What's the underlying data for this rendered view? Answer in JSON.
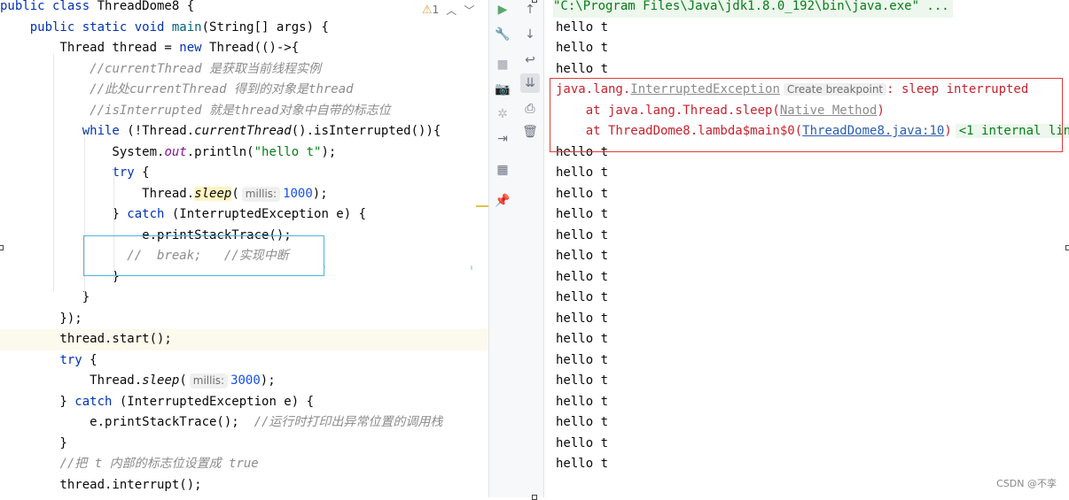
{
  "editor": {
    "warning_count": "1",
    "lines": [
      [
        [
          "kw",
          "public class "
        ],
        [
          "",
          "ThreadDome8 {"
        ]
      ],
      [
        [
          "",
          "    "
        ],
        [
          "kw",
          "public static void "
        ],
        [
          "fn",
          "main"
        ],
        [
          "",
          "(String[] args) {"
        ]
      ],
      [
        [
          "",
          "        Thread thread = "
        ],
        [
          "kw",
          "new "
        ],
        [
          "",
          "Thread(()->{"
        ]
      ],
      [
        [
          "",
          "            "
        ],
        [
          "cmt",
          "//currentThread 是获取当前线程实例"
        ]
      ],
      [
        [
          "",
          "            "
        ],
        [
          "cmt",
          "//此处currentThread 得到的对象是thread"
        ]
      ],
      [
        [
          "",
          "            "
        ],
        [
          "cmt",
          "//isInterrupted 就是thread对象中自带的标志位"
        ]
      ],
      [
        [
          "",
          "           "
        ],
        [
          "kw",
          "while "
        ],
        [
          "",
          "(!Thread."
        ],
        [
          "it",
          "currentThread"
        ],
        [
          "",
          "().isInterrupted()){"
        ]
      ],
      [
        [
          "",
          "               System."
        ],
        [
          "fld",
          "out"
        ],
        [
          "",
          ".println("
        ],
        [
          "str",
          "\"hello t\""
        ],
        [
          "",
          ");"
        ]
      ],
      [
        [
          "",
          "               "
        ],
        [
          "kw",
          "try "
        ],
        [
          "",
          "{"
        ]
      ],
      [
        [
          "",
          "                   Thread."
        ],
        [
          "it hint2",
          "sleep"
        ],
        [
          "",
          "("
        ],
        [
          "hint",
          "millis:"
        ],
        [
          "num",
          "1000"
        ],
        [
          "",
          ");"
        ]
      ],
      [
        [
          "",
          "               } "
        ],
        [
          "kw",
          "catch "
        ],
        [
          "",
          "(InterruptedException e) {"
        ]
      ],
      [
        [
          "",
          "                   e.printStackTrace();"
        ]
      ],
      [
        [
          "",
          "                 "
        ],
        [
          "cmt",
          "//  break;   //实现中断"
        ]
      ],
      [
        [
          "",
          "               }"
        ]
      ],
      [
        [
          "",
          "           }"
        ]
      ],
      [
        [
          "",
          "        });"
        ]
      ],
      [
        [
          "",
          "        thread.start();"
        ]
      ],
      [
        [
          "",
          "        "
        ],
        [
          "kw",
          "try "
        ],
        [
          "",
          "{"
        ]
      ],
      [
        [
          "",
          "            Thread."
        ],
        [
          "it",
          "sleep"
        ],
        [
          "",
          "("
        ],
        [
          "hint",
          "millis:"
        ],
        [
          "num",
          "3000"
        ],
        [
          "",
          ");"
        ]
      ],
      [
        [
          "",
          "        } "
        ],
        [
          "kw",
          "catch "
        ],
        [
          "",
          "(InterruptedException e) {"
        ]
      ],
      [
        [
          "",
          "            e.printStackTrace();  "
        ],
        [
          "cmt",
          "//运行时打印出异常位置的调用栈"
        ]
      ],
      [
        [
          "",
          "        }"
        ]
      ],
      [
        [
          "",
          "        "
        ],
        [
          "cmt",
          "//把 t 内部的标志位设置成 true"
        ]
      ],
      [
        [
          "",
          "        thread.interrupt();"
        ]
      ]
    ]
  },
  "toolbar": {
    "icons": [
      "rerun-icon",
      "wrench-icon",
      "stop-icon",
      "camera-icon",
      "bug-settings-icon",
      "login-icon",
      "layout-icon",
      "pin-icon"
    ],
    "icons2": [
      "up-arrow-icon",
      "down-arrow-icon",
      "soft-wrap-icon",
      "scroll-to-end-icon",
      "print-icon",
      "trash-icon"
    ]
  },
  "console": {
    "cmd": "\"C:\\Program Files\\Java\\jdk1.8.0_192\\bin\\java.exe\" ...",
    "hello_before": [
      "hello t",
      "hello t",
      "hello t"
    ],
    "exc_pkg": "java.lang.",
    "exc_class": "InterruptedException",
    "create_breakpoint": "Create breakpoint",
    "exc_msg": ": sleep interrupted",
    "st1_pre": "    at java.lang.Thread.sleep(",
    "st1_link": "Native Method",
    "st1_post": ")",
    "st2_pre": "    at ThreadDome8.lambda$main$0(",
    "st2_link": "ThreadDome8.java:10",
    "st2_post": ")",
    "internal_lines": "<1 internal line>",
    "hello_after": [
      "hello t",
      "hello t",
      "hello t",
      "hello t",
      "hello t",
      "hello t",
      "hello t",
      "hello t",
      "hello t",
      "hello t",
      "hello t",
      "hello t",
      "hello t",
      "hello t",
      "hello t",
      "hello t"
    ]
  },
  "watermark": "CSDN @不孪"
}
